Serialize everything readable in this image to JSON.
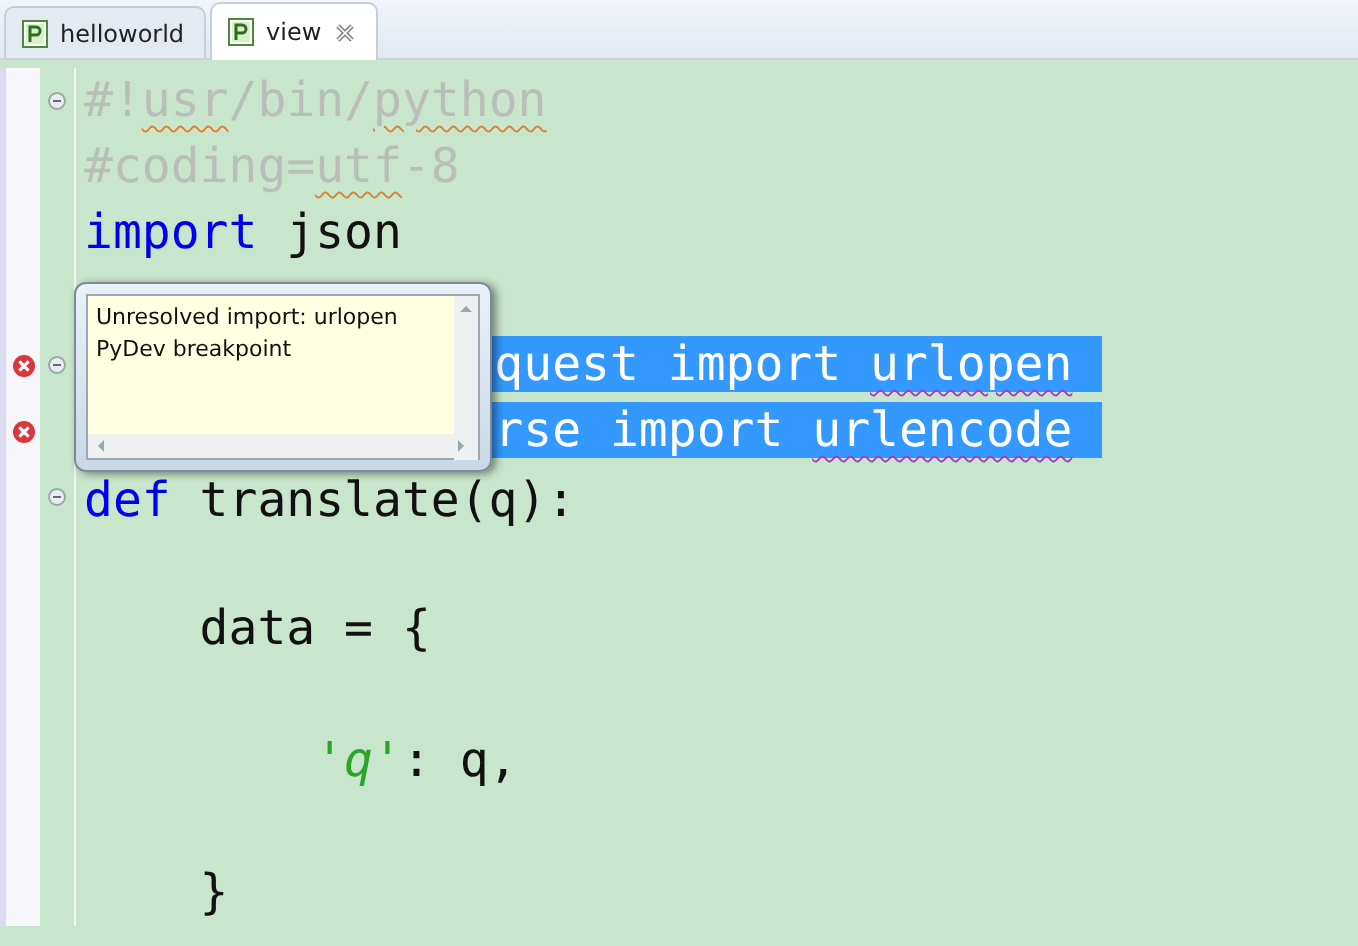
{
  "tabs": [
    {
      "label": "helloworld",
      "selected": false
    },
    {
      "label": "view",
      "selected": true
    }
  ],
  "lines": [
    {
      "fold": true,
      "error": false,
      "selected": false,
      "partial": false,
      "tokens": [
        {
          "text": "#!",
          "kind": "comment"
        },
        {
          "text": "usr",
          "kind": "typo"
        },
        {
          "text": "/bin/",
          "kind": "comment"
        },
        {
          "text": "python",
          "kind": "typo"
        }
      ]
    },
    {
      "fold": false,
      "error": false,
      "selected": false,
      "partial": false,
      "tokens": [
        {
          "text": "#coding=",
          "kind": "comment"
        },
        {
          "text": "utf",
          "kind": "typo"
        },
        {
          "text": "-8",
          "kind": "comment"
        }
      ]
    },
    {
      "fold": false,
      "error": false,
      "selected": false,
      "partial": false,
      "tokens": [
        {
          "text": "import",
          "kind": "keyword"
        },
        {
          "text": " json",
          "kind": "plain"
        }
      ]
    },
    {
      "fold": false,
      "error": false,
      "selected": false
    },
    {
      "fold": true,
      "error": true,
      "selected": true,
      "partial": true,
      "tokens": [
        {
          "text": "quest import ",
          "kind": "plain"
        },
        {
          "text": "urlopen",
          "kind": "unresolved"
        }
      ]
    },
    {
      "fold": false,
      "error": true,
      "selected": true,
      "partial": true,
      "tokens": [
        {
          "text": "rse import ",
          "kind": "plain"
        },
        {
          "text": "urlencode",
          "kind": "unresolved"
        }
      ]
    },
    {
      "fold": true,
      "error": false,
      "selected": false,
      "partial": false,
      "tokens": [
        {
          "text": "def",
          "kind": "keyword"
        },
        {
          "text": " translate(q):",
          "kind": "plain"
        }
      ]
    },
    {
      "fold": false,
      "error": false,
      "selected": false
    },
    {
      "fold": false,
      "error": false,
      "selected": false,
      "partial": false,
      "tokens": [
        {
          "text": "    data = {",
          "kind": "plain"
        }
      ]
    },
    {
      "fold": false,
      "error": false,
      "selected": false
    },
    {
      "fold": false,
      "error": false,
      "selected": false,
      "partial": false,
      "tokens": [
        {
          "text": "        'q'",
          "kind": "string"
        },
        {
          "text": ": q,",
          "kind": "plain"
        }
      ]
    },
    {
      "fold": false,
      "error": false,
      "selected": false
    },
    {
      "fold": false,
      "error": false,
      "selected": false,
      "partial": false,
      "tokens": [
        {
          "text": "    }",
          "kind": "plain"
        }
      ]
    }
  ],
  "popup": {
    "messages": [
      "Unresolved import: urlopen",
      "PyDev breakpoint"
    ]
  }
}
